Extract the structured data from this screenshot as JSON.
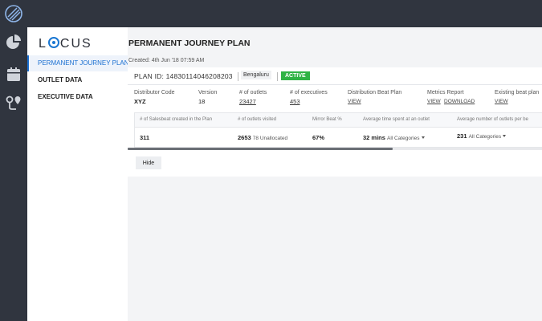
{
  "brand": {
    "name_before": "L",
    "name_after": "CUS"
  },
  "nav": {
    "items": [
      {
        "label": "PERMANENT JOURNEY PLAN",
        "active": true
      },
      {
        "label": "OUTLET DATA",
        "active": false
      },
      {
        "label": "EXECUTIVE DATA",
        "active": false
      }
    ]
  },
  "rail": {
    "icons": [
      "pie-chart-icon",
      "calendar-icon",
      "route-pin-icon"
    ]
  },
  "main": {
    "title": "PERMANENT JOURNEY PLAN",
    "created": "Created: 4th Jun '18 07:59 AM"
  },
  "plan": {
    "id_text": "PLAN ID: 14830114046208203",
    "region": "Bengaluru",
    "status": "ACTIVE",
    "fields": [
      {
        "label": "Distributor Code",
        "value": "XYZ"
      },
      {
        "label": "Version",
        "value": "18"
      },
      {
        "label": "# of outlets",
        "value": "23427"
      },
      {
        "label": "# of executives",
        "value": "453"
      },
      {
        "label": "Distribution Beat Plan",
        "value": "VIEW"
      },
      {
        "label": "Metrics Report",
        "value_view": "VIEW",
        "value_download": "DOWNLOAD"
      },
      {
        "label": "Existing beat plan",
        "value": "VIEW"
      }
    ]
  },
  "stats": {
    "labels": [
      "# of Salesbeat created in the Plan",
      "# of outlets visited",
      "Mirror Beat %",
      "Average time spent at an outlet",
      "Average number of outlets per be"
    ],
    "values": [
      {
        "main": "311"
      },
      {
        "main": "2653",
        "sub": "78 Unallocated"
      },
      {
        "main": "67%"
      },
      {
        "main": "32 mins",
        "sub": "All Categories"
      },
      {
        "main": "231",
        "sub": "All Categories"
      }
    ]
  },
  "scroll": {
    "position": 0.64
  },
  "actions": {
    "hide_label": "Hide"
  },
  "colors": {
    "accent": "#1a6fd1",
    "active_badge": "#2fb344",
    "sidebar": "#30353f"
  }
}
